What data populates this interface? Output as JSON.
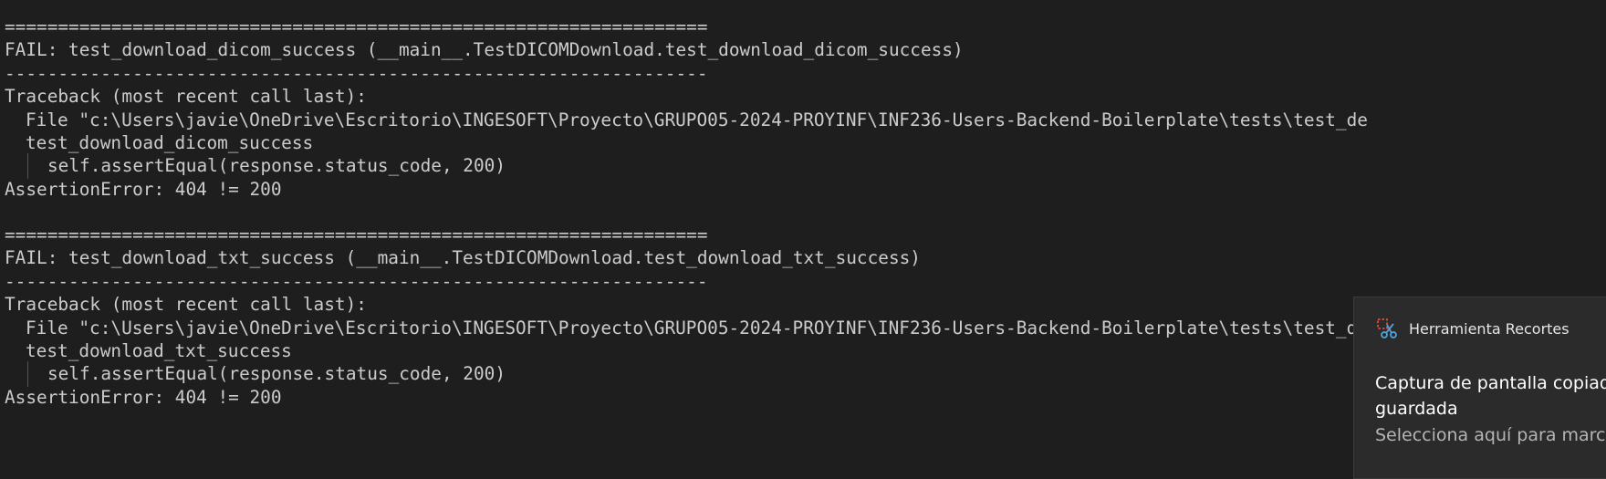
{
  "terminal": {
    "lines": [
      "==================================================================",
      "FAIL: test_download_dicom_success (__main__.TestDICOMDownload.test_download_dicom_success)",
      "------------------------------------------------------------------",
      "Traceback (most recent call last):",
      "File \"c:\\Users\\javie\\OneDrive\\Escritorio\\INGESOFT\\Proyecto\\GRUPO05-2024-PROYINF\\INF236-Users-Backend-Boilerplate\\tests\\test_de",
      "test_download_dicom_success",
      "self.assertEqual(response.status_code, 200)",
      "AssertionError: 404 != 200",
      "==================================================================",
      "FAIL: test_download_txt_success (__main__.TestDICOMDownload.test_download_txt_success)",
      "------------------------------------------------------------------",
      "Traceback (most recent call last):",
      "File \"c:\\Users\\javie\\OneDrive\\Escritorio\\INGESOFT\\Proyecto\\GRUPO05-2024-PROYINF\\INF236-Users-Backend-Boilerplate\\tests\\test_de",
      "test_download_txt_success",
      "self.assertEqual(response.status_code, 200)",
      "AssertionError: 404 != 200"
    ]
  },
  "toast": {
    "app_name": "Herramienta Recortes",
    "app_icon": "snipping-tool-icon",
    "title": "Captura de pantalla copiada guardada",
    "body": "Selecciona aquí para marca"
  },
  "colors": {
    "terminal_bg": "#1e1e1e",
    "terminal_text": "#cccccc",
    "toast_bg": "#2b2b2b",
    "icon_accent": "#4fa3e0",
    "icon_red": "#e04a3f"
  }
}
